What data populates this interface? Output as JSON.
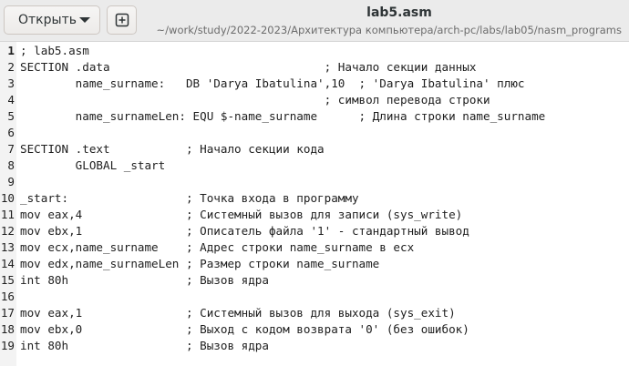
{
  "header": {
    "open_label": "Открыть",
    "title": "lab5.asm",
    "path": "~/work/study/2022-2023/Архитектура компьютера/arch-pc/labs/lab05/nasm_programs"
  },
  "editor": {
    "current_line": 1,
    "lines": [
      "; lab5.asm",
      "SECTION .data                               ; Начало секции данных",
      "        name_surname:   DB 'Darya Ibatulina',10  ; 'Darya Ibatulina' плюс",
      "                                            ; символ перевода строки",
      "        name_surnameLen: EQU $-name_surname      ; Длина строки name_surname",
      "",
      "SECTION .text           ; Начало секции кода",
      "        GLOBAL _start",
      "",
      "_start:                 ; Точка входа в программу",
      "mov eax,4               ; Системный вызов для записи (sys_write)",
      "mov ebx,1               ; Описатель файла '1' - стандартный вывод",
      "mov ecx,name_surname    ; Адрес строки name_surname в ecx",
      "mov edx,name_surnameLen ; Размер строки name_surname",
      "int 80h                 ; Вызов ядра",
      "",
      "mov eax,1               ; Системный вызов для выхода (sys_exit)",
      "mov ebx,0               ; Выход с кодом возврата '0' (без ошибок)",
      "int 80h                 ; Вызов ядра"
    ]
  }
}
